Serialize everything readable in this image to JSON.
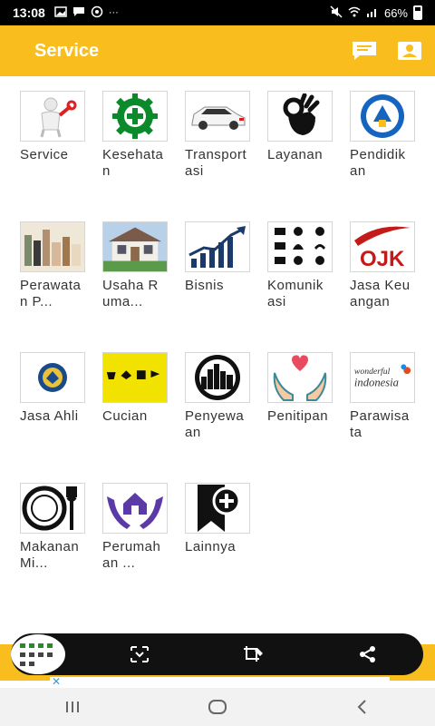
{
  "statusbar": {
    "time": "13:08",
    "battery": "66%",
    "icons": [
      "image-icon",
      "message-icon",
      "whatsapp-icon",
      "more-icon"
    ]
  },
  "appbar": {
    "title": "Service"
  },
  "tiles": [
    {
      "label": "Service",
      "icon": "wrench-man-icon"
    },
    {
      "label": "Kesehatan",
      "icon": "health-gear-icon"
    },
    {
      "label": "Transportasi",
      "icon": "car-icon"
    },
    {
      "label": "Layanan",
      "icon": "ok-hand-icon"
    },
    {
      "label": "Pendidikan",
      "icon": "education-emblem-icon"
    },
    {
      "label": "Perawatan P...",
      "icon": "beauty-products-icon"
    },
    {
      "label": "Usaha Ruma...",
      "icon": "house-icon"
    },
    {
      "label": "Bisnis",
      "icon": "chart-up-icon"
    },
    {
      "label": "Komunikasi",
      "icon": "communication-icons-icon"
    },
    {
      "label": "Jasa Keuangan",
      "icon": "ojk-logo-icon"
    },
    {
      "label": "Jasa Ahli",
      "icon": "emblem-icon"
    },
    {
      "label": "Cucian",
      "icon": "laundry-symbols-icon"
    },
    {
      "label": "Penyewaan",
      "icon": "city-lens-icon"
    },
    {
      "label": "Penitipan",
      "icon": "hands-heart-icon"
    },
    {
      "label": "Parawisata",
      "icon": "wonderful-indonesia-icon"
    },
    {
      "label": "Makanan Mi...",
      "icon": "plate-fork-icon"
    },
    {
      "label": "Perumahan ...",
      "icon": "hands-house-icon"
    },
    {
      "label": "Lainnya",
      "icon": "bookmark-plus-icon"
    }
  ],
  "tile_text": {
    "wonderful": "wonderful",
    "indonesia": "indonesia",
    "ojk": "OJK"
  },
  "colors": {
    "accent": "#F9BE1D",
    "toolbar": "#111111"
  },
  "navbar": {
    "items": [
      "recent-apps-icon",
      "home-icon",
      "back-icon"
    ]
  }
}
